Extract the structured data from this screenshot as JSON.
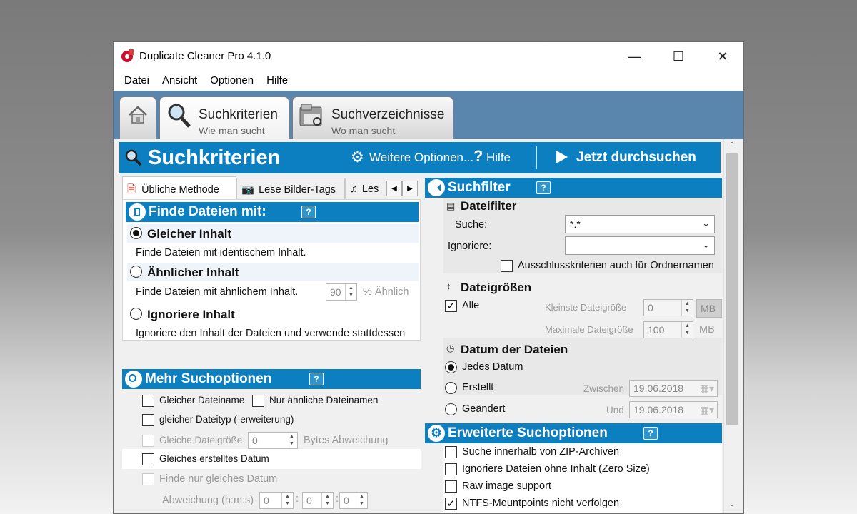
{
  "window": {
    "title": "Duplicate Cleaner Pro 4.1.0",
    "accent": "#0c7fc1"
  },
  "menu": [
    "Datei",
    "Ansicht",
    "Optionen",
    "Hilfe"
  ],
  "big_tabs": [
    {
      "title": "Suchkriterien",
      "subtitle": "Wie man sucht"
    },
    {
      "title": "Suchverzeichnisse",
      "subtitle": "Wo man sucht"
    }
  ],
  "header": {
    "title": "Suchkriterien",
    "options": "Weitere Optionen...",
    "help": "Hilfe",
    "run": "Jetzt durchsuchen"
  },
  "subtabs": [
    "Übliche Methode",
    "Lese Bilder-Tags",
    "Les"
  ],
  "finde": {
    "title": "Finde Dateien mit:",
    "opt1": {
      "label": "Gleicher Inhalt",
      "desc": "Finde Dateien mit identischem Inhalt.",
      "selected": true
    },
    "opt2": {
      "label": "Ähnlicher Inhalt",
      "desc": "Finde Dateien mit ähnlichem Inhalt.",
      "value": "90",
      "unit": "% Ähnlich"
    },
    "opt3": {
      "label": "Ignoriere Inhalt",
      "desc": "Ignoriere den Inhalt der Dateien und verwende stattdessen"
    }
  },
  "mehr": {
    "title": "Mehr Suchoptionen",
    "gleicher_name": "Gleicher Dateiname",
    "aehnliche_namen": "Nur ähnliche Dateinamen",
    "dateityp": "gleicher Dateityp (-erweiterung)",
    "groesse": "Gleiche Dateigröße",
    "groesse_value": "0",
    "bytes": "Bytes Abweichung",
    "erstellt": "Gleiches erstelltes Datum",
    "gleiches_datum": "Finde nur gleiches Datum",
    "abweichung": "Abweichung (h:m:s)",
    "h": "0",
    "m": "0",
    "s": "0",
    "sep": ":"
  },
  "filter": {
    "title": "Suchfilter",
    "dateifilter": "Dateifilter",
    "suche_label": "Suche:",
    "suche_value": "*.*",
    "ignoriere_label": "Ignoriere:",
    "ignoriere_value": "",
    "ausschluss": "Ausschlusskriterien auch für Ordnernamen",
    "groessen": "Dateigrößen",
    "alle": "Alle",
    "kleinste": "Kleinste Dateigröße",
    "kleinste_value": "0",
    "maximale": "Maximale Dateigröße",
    "maximale_value": "100",
    "unit": "MB",
    "datum": "Datum der Dateien",
    "jedes": "Jedes Datum",
    "erstellt": "Erstellt",
    "zwischen": "Zwischen",
    "date1": "19.06.2018",
    "geaendert": "Geändert",
    "und": "Und",
    "date2": "19.06.2018"
  },
  "erweitert": {
    "title": "Erweiterte Suchoptionen",
    "zip": "Suche innerhalb von ZIP-Archiven",
    "zero": "Ignoriere Dateien ohne Inhalt (Zero Size)",
    "raw": "Raw image support",
    "ntfs": "NTFS-Mountpoints nicht verfolgen"
  }
}
